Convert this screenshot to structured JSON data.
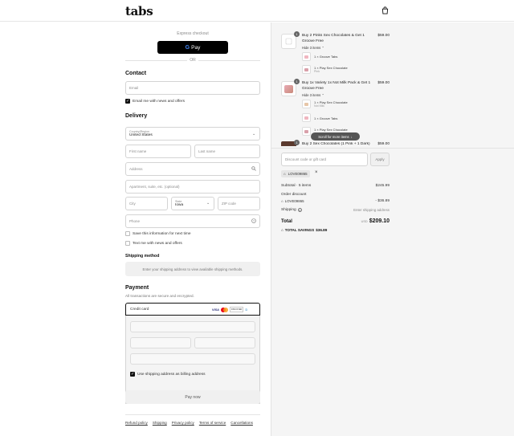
{
  "brand": {
    "logo_text": "tabs"
  },
  "express": {
    "title": "Express checkout",
    "gpay_label": "Pay",
    "gpay_g": "G",
    "or_label": "OR"
  },
  "contact": {
    "heading": "Contact",
    "email_placeholder": "Email",
    "newsletter_label": "Email me with news and offers"
  },
  "delivery": {
    "heading": "Delivery",
    "country_caption": "Country/Region",
    "country_value": "United States",
    "first_name": "First name",
    "last_name": "Last name",
    "address": "Address",
    "apartment": "Apartment, suite, etc. (optional)",
    "city": "City",
    "state_caption": "State",
    "state_value": "Iowa",
    "zip": "ZIP code",
    "phone": "Phone",
    "save_info": "Save this information for next time",
    "text_me": "Text me with news and offers"
  },
  "shipping_method": {
    "heading": "Shipping method",
    "message": "Enter your shipping address to view available shipping methods."
  },
  "payment": {
    "heading": "Payment",
    "subtitle": "All transactions are secure and encrypted.",
    "method_label": "Credit card",
    "card_brands": [
      "VISA",
      "MC",
      "DISCOVER",
      "D"
    ],
    "billing_label": "Use shipping address as billing address",
    "pay_now": "Pay now"
  },
  "footer": {
    "links": [
      "Refund policy",
      "Shipping",
      "Privacy policy",
      "Terms of service",
      "Cancellations"
    ]
  },
  "order": {
    "items": [
      {
        "qty": "1",
        "title": "Buy 2 Pinks Sex Chocolates & Get 1 Groove Free",
        "price": "$59.00",
        "hide_label": "Hide 3 items",
        "children": [
          {
            "text": "1 × Groove Tabs",
            "sub": ""
          },
          {
            "text": "1 × Play Sex Chocolate",
            "sub": "Pink"
          }
        ]
      },
      {
        "qty": "1",
        "title": "Buy 1x Variety 1x Not Milk Pack & Get 1 Groove Free",
        "price": "$59.00",
        "hide_label": "Hide 3 items",
        "children": [
          {
            "text": "1 × Play Sex Chocolate",
            "sub": "Not Milk"
          },
          {
            "text": "1 × Groove Tabs",
            "sub": ""
          },
          {
            "text": "1 × Play Sex Chocolate",
            "sub": ""
          }
        ]
      },
      {
        "qty": "1",
        "title": "Buy 2 Sex Chocolates (1 Pink + 1 Dark) &",
        "price": "$59.00"
      }
    ],
    "scroll_hint": "Scroll for more items",
    "discount_placeholder": "Discount code or gift card",
    "apply_label": "Apply",
    "code_chip": "LOVE09865",
    "subtotal_label": "Subtotal · 5 items",
    "subtotal_value": "$245.99",
    "order_discount_label": "Order discount",
    "discount_code": "LOVE09865",
    "discount_value": "- $36.89",
    "shipping_label": "Shipping",
    "shipping_value": "Enter shipping address",
    "total_label": "Total",
    "total_currency": "USD",
    "total_value": "$209.10",
    "savings_label": "TOTAL SAVINGS",
    "savings_value": "$36.89"
  },
  "colors": {
    "primary": "#111111",
    "panel": "#f5f5f5",
    "accent_pink": "#e8aab5"
  }
}
